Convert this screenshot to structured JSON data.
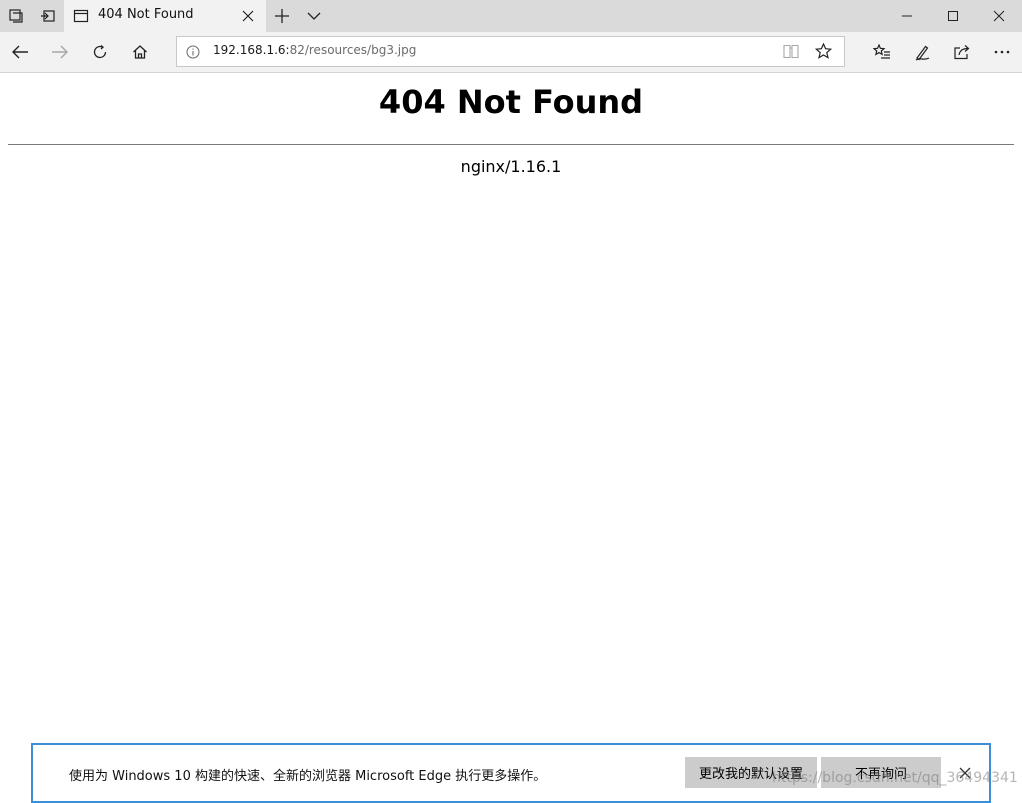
{
  "titlebar": {
    "tab": {
      "title": "404 Not Found"
    },
    "icons": [
      "tab-preview-icon",
      "tabs-aside-icon",
      "page-icon",
      "close-icon",
      "plus-icon",
      "chevron-down-icon",
      "minimize-icon",
      "maximize-icon",
      "close-icon"
    ]
  },
  "navbar": {
    "url_host": "192.168.1.6:",
    "url_rest": "82/resources/bg3.jpg",
    "icons": [
      "back-arrow-icon",
      "forward-arrow-icon",
      "refresh-icon",
      "home-icon",
      "info-icon",
      "reading-view-icon",
      "star-icon",
      "favorites-list-icon",
      "pen-icon",
      "share-icon",
      "more-icon"
    ]
  },
  "page": {
    "heading": "404 Not Found",
    "server": "nginx/1.16.1"
  },
  "notification": {
    "message": "使用为 Windows 10 构建的快速、全新的浏览器 Microsoft Edge 执行更多操作。",
    "default_button": "更改我的默认设置",
    "never_button": "不再询问"
  },
  "watermark": "https://blog.csdn.net/qq_36494341",
  "colors": {
    "titlebar_bg": "#dadada",
    "tab_bg": "#f2f2f2",
    "notification_border": "#3c8fd6",
    "button_bg": "#cccccc"
  }
}
